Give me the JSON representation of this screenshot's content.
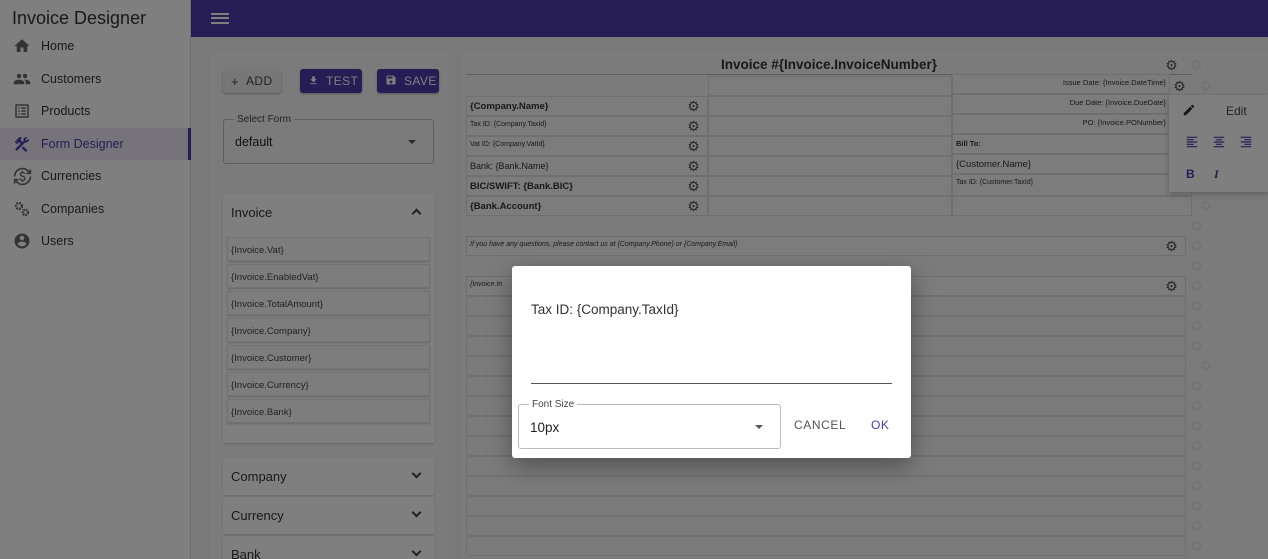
{
  "app": {
    "title": "Invoice Designer"
  },
  "sidebar": {
    "items": [
      {
        "label": "Home",
        "icon": "home-icon"
      },
      {
        "label": "Customers",
        "icon": "people-icon"
      },
      {
        "label": "Products",
        "icon": "list-icon"
      },
      {
        "label": "Form Designer",
        "icon": "tools-icon",
        "active": true
      },
      {
        "label": "Currencies",
        "icon": "currency-exchange-icon"
      },
      {
        "label": "Companies",
        "icon": "gears-icon"
      },
      {
        "label": "Users",
        "icon": "user-circle-icon"
      }
    ]
  },
  "toolbar": {
    "add_label": "ADD",
    "test_label": "TEST",
    "save_label": "SAVE"
  },
  "select_form": {
    "legend": "Select Form",
    "value": "default"
  },
  "accordions": {
    "invoice": {
      "title": "Invoice",
      "fields": [
        "{Invoice.Vat}",
        "{Invoice.EnabledVat}",
        "{Invoice.TotalAmount}",
        "{Invoice.Company}",
        "{Invoice.Customer}",
        "{Invoice.Currency}",
        "{Invoice.Bank}"
      ]
    },
    "company": {
      "title": "Company"
    },
    "currency": {
      "title": "Currency"
    },
    "bank": {
      "title": "Bank"
    }
  },
  "canvas": {
    "title": "Invoice #{Invoice.InvoiceNumber}",
    "issue_date": "Issue Date: {Invoice.DateTime}",
    "due_date": "Due Date: {Invoice.DueDate}",
    "po": "PO: {Invoice.PONumber}",
    "company_name": "{Company.Name}",
    "tax_id": "Tax ID: {Company.TaxId}",
    "vat_id": "Vat ID: {Company.VatId}",
    "bank": "Bank: {Bank.Name}",
    "bic": "BIC/SWIFT: {Bank.BIC}",
    "account": "{Bank.Account}",
    "bill_to": "Bill To:",
    "customer_name": "{Customer.Name}",
    "customer_tax": "Tax ID: {Customer.TaxId}",
    "contact_line": "If you have any questions, please contact us at {Company.Phone} or {Company.Email}",
    "partial_line": "{Invoice.In"
  },
  "format_popup": {
    "edit_label": "Edit"
  },
  "dialog": {
    "text": "Tax ID: {Company.TaxId}",
    "font_size_legend": "Font Size",
    "font_size_value": "10px",
    "cancel_label": "CANCEL",
    "ok_label": "OK"
  },
  "colors": {
    "primary": "#4d3bab",
    "overlay": "rgba(0,0,0,0.5)"
  }
}
